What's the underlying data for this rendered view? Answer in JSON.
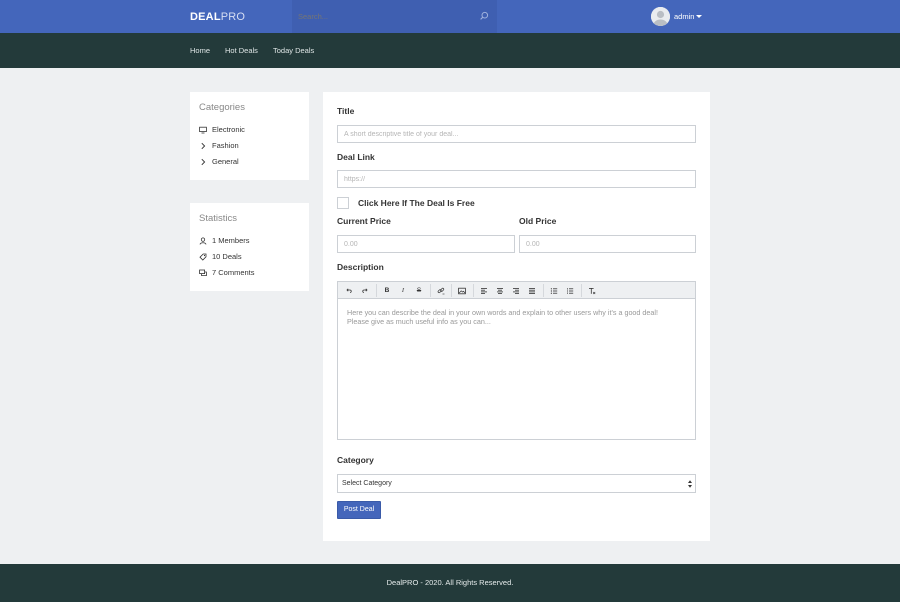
{
  "header": {
    "logo_bold": "DEAL",
    "logo_light": "PRO",
    "search_placeholder": "Search...",
    "username": "admin"
  },
  "nav": {
    "items": [
      {
        "label": "Home"
      },
      {
        "label": "Hot Deals"
      },
      {
        "label": "Today Deals"
      }
    ]
  },
  "sidebar": {
    "categories_title": "Categories",
    "categories": [
      {
        "label": "Electronic",
        "icon": "monitor-icon"
      },
      {
        "label": "Fashion",
        "icon": "chevron-right-icon"
      },
      {
        "label": "General",
        "icon": "chevron-right-icon"
      }
    ],
    "statistics_title": "Statistics",
    "statistics": [
      {
        "label": "1 Members",
        "icon": "user-icon"
      },
      {
        "label": "10 Deals",
        "icon": "tag-icon"
      },
      {
        "label": "7 Comments",
        "icon": "comments-icon"
      }
    ]
  },
  "form": {
    "title_label": "Title",
    "title_placeholder": "A short descriptive title of your deal...",
    "link_label": "Deal Link",
    "link_placeholder": "https://",
    "free_label": "Click Here If The Deal Is Free",
    "current_price_label": "Current Price",
    "current_price_placeholder": "0.00",
    "old_price_label": "Old Price",
    "old_price_placeholder": "0.00",
    "description_label": "Description",
    "description_placeholder_line1": "Here you can describe the deal in your own words and explain to other users why it's a good deal!",
    "description_placeholder_line2": "Please give as much useful info as you can...",
    "category_label": "Category",
    "category_selected": "Select Category",
    "submit_label": "Post Deal"
  },
  "footer": {
    "text": "DealPRO - 2020. All Rights Reserved."
  },
  "colors": {
    "header_blue": "#4466bb",
    "nav_dark": "#233a3a",
    "page_bg": "#eef0f2"
  }
}
